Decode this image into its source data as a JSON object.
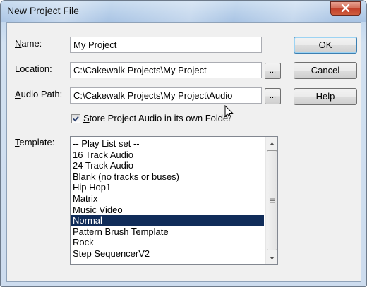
{
  "window": {
    "title": "New Project File",
    "close_icon": "close-icon"
  },
  "fields": {
    "name": {
      "label_underlined": "N",
      "label_rest": "ame:",
      "value": "My Project"
    },
    "location": {
      "label_underlined": "L",
      "label_rest": "ocation:",
      "value": "C:\\Cakewalk Projects\\My Project",
      "browse_label": "..."
    },
    "audio_path": {
      "label_underlined": "A",
      "label_rest": "udio Path:",
      "value": "C:\\Cakewalk Projects\\My Project\\Audio",
      "browse_label": "..."
    },
    "store_audio": {
      "checked": true,
      "label_underlined": "S",
      "label_rest": "tore Project Audio in its own Folder"
    }
  },
  "template": {
    "label_underlined": "T",
    "label_rest": "emplate:",
    "items": [
      "-- Play List set --",
      "16 Track Audio",
      "24 Track Audio",
      "Blank (no tracks or buses)",
      "Hip Hop1",
      "Matrix",
      "Music Video",
      "Normal",
      "Pattern Brush Template",
      "Rock",
      "Step SequencerV2"
    ],
    "selected_index": 7
  },
  "buttons": {
    "ok": "OK",
    "cancel": "Cancel",
    "help": "Help"
  },
  "colors": {
    "selection": "#102c59",
    "close_button": "#c9472f"
  }
}
